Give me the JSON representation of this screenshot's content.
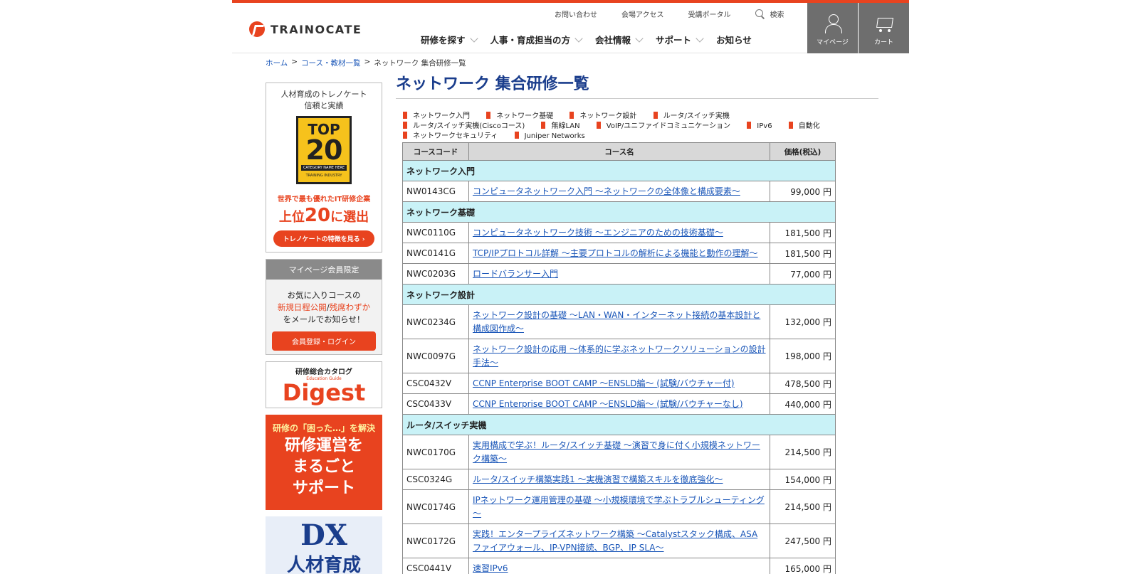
{
  "header": {
    "logo": "TRAINOCATE",
    "util_nav": [
      "お問い合わせ",
      "会場アクセス",
      "受講ポータル"
    ],
    "search_label": "検索",
    "main_nav": [
      "研修を探す",
      "人事・育成担当の方",
      "会社情報",
      "サポート",
      "お知らせ"
    ],
    "mypage_label": "マイページ",
    "cart_label": "カート"
  },
  "breadcrumb": [
    "ホーム",
    "コース・教材一覧",
    "ネットワーク 集合研修一覧"
  ],
  "sidebar": {
    "top20": {
      "line1": "人材育成のトレノケート",
      "line2": "信頼と実績",
      "badge_top": "TOP",
      "badge_num": "20",
      "badge_cat": "CATEGORY NAME HERE",
      "badge_brand": "TRAINING INDUSTRY",
      "red1": "世界で最も優れたIT研修企業",
      "red2_pre": "上位",
      "red2_num": "20",
      "red2_post": "に選出",
      "button": "トレノケートの特徴を見る ›"
    },
    "member": {
      "head": "マイページ会員限定",
      "l1": "お気に入りコースの",
      "l2a": "新規日程公開",
      "l2b": "/",
      "l2c": "残席わずか",
      "l3": "をメールでお知らせ！",
      "button": "会員登録・ログイン"
    },
    "digest": {
      "sub": "研修総合カタログ",
      "small": "Education Guide",
      "main": "Digest"
    },
    "support": {
      "sub": "研修の「困った…」を解決",
      "l1": "研修運営を",
      "l2": "まるごと",
      "l3": "サポート"
    },
    "dx": {
      "main": "DX",
      "sub": "人材育成"
    }
  },
  "content": {
    "title": "ネットワーク 集合研修一覧",
    "categories": [
      "ネットワーク入門",
      "ネットワーク基礎",
      "ネットワーク設計",
      "ルータ/スイッチ実機",
      "ルータ/スイッチ実機(Ciscoコース)",
      "無線LAN",
      "VoIP/ユニファイドコミュニケーション",
      "IPv6",
      "自動化",
      "ネットワークセキュリティ",
      "Juniper Networks"
    ],
    "table_headers": [
      "コースコード",
      "コース名",
      "価格(税込)"
    ],
    "sections": [
      {
        "category": "ネットワーク入門",
        "rows": [
          {
            "code": "NW0143CG",
            "name": "コンピュータネットワーク入門 ～ネットワークの全体像と構成要素～",
            "price": "99,000 円",
            "tall": false
          }
        ]
      },
      {
        "category": "ネットワーク基礎",
        "rows": [
          {
            "code": "NWC0110G",
            "name": "コンピュータネットワーク技術 ～エンジニアのための技術基礎～",
            "price": "181,500 円",
            "tall": false
          },
          {
            "code": "NWC0141G",
            "name": "TCP/IPプロトコル詳解 ～主要プロトコルの解析による機能と動作の理解～",
            "price": "181,500 円",
            "tall": false
          },
          {
            "code": "NWC0203G",
            "name": "ロードバランサー入門",
            "price": "77,000 円",
            "tall": false
          }
        ]
      },
      {
        "category": "ネットワーク設計",
        "rows": [
          {
            "code": "NWC0234G",
            "name": "ネットワーク設計の基礎 ～LAN・WAN・インターネット接続の基本設計と構成図作成～",
            "price": "132,000 円",
            "tall": true
          },
          {
            "code": "NWC0097G",
            "name": "ネットワーク設計の応用 ～体系的に学ぶネットワークソリューションの設計手法～",
            "price": "198,000 円",
            "tall": true
          },
          {
            "code": "CSC0432V",
            "name": "CCNP Enterprise BOOT CAMP ～ENSLD編～ (試験/バウチャー付)",
            "price": "478,500 円",
            "tall": false
          },
          {
            "code": "CSC0433V",
            "name": "CCNP Enterprise BOOT CAMP ～ENSLD編～ (試験/バウチャーなし)",
            "price": "440,000 円",
            "tall": false
          }
        ]
      },
      {
        "category": "ルータ/スイッチ実機",
        "rows": [
          {
            "code": "NWC0170G",
            "name": "実用構成で学ぶ！ルータ/スイッチ基礎 ～演習で身に付く小規模ネットワーク構築～",
            "price": "214,500 円",
            "tall": true
          },
          {
            "code": "CSC0324G",
            "name": "ルータ/スイッチ構築実践1 ～実機演習で構築スキルを徹底強化～",
            "price": "154,000 円",
            "tall": false
          },
          {
            "code": "NWC0174G",
            "name": "IPネットワーク運用管理の基礎 ～小規模環境で学ぶトラブルシューティング～",
            "price": "214,500 円",
            "tall": true
          },
          {
            "code": "NWC0172G",
            "name": "実践！エンタープライズネットワーク構築 ～Catalystスタック構成、ASAファイアウォール、IP-VPN接続、BGP、IP SLA～",
            "price": "247,500 円",
            "tall": true
          },
          {
            "code": "CSC0441V",
            "name": "速習IPv6",
            "price": "165,000 円",
            "tall": false
          }
        ]
      }
    ]
  }
}
